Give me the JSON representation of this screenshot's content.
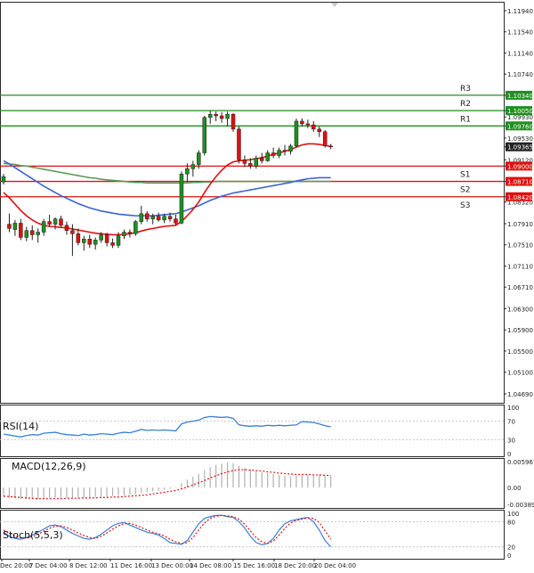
{
  "chart_data": [
    {
      "type": "candlestick",
      "panel": "main",
      "ylim": [
        1.0469,
        1.1194
      ],
      "y_ticks": [
        "1.11940",
        "1.11540",
        "1.11140",
        "1.10740",
        "1.10340",
        "1.10050",
        "1.09930",
        "1.09760",
        "1.09530",
        "1.09365",
        "1.09120",
        "1.09000",
        "1.08710",
        "1.08420",
        "1.08320",
        "1.07910",
        "1.07510",
        "1.07110",
        "1.06710",
        "1.06300",
        "1.05900",
        "1.05500",
        "1.05100",
        "1.04690"
      ],
      "highlighted_ticks": [
        {
          "label": "1.10340",
          "color": "#1f8f1f"
        },
        {
          "label": "1.10050",
          "color": "#1f8f1f"
        },
        {
          "label": "1.09760",
          "color": "#1f8f1f"
        },
        {
          "label": "1.09365",
          "color": "#222222"
        },
        {
          "label": "1.09000",
          "color": "#e01010"
        },
        {
          "label": "1.08710",
          "color": "#e01010"
        },
        {
          "label": "1.08420",
          "color": "#e01010"
        }
      ],
      "levels": [
        {
          "name": "R3",
          "value": 1.1034,
          "color": "#1f8f1f"
        },
        {
          "name": "R2",
          "value": 1.1005,
          "color": "#1f8f1f"
        },
        {
          "name": "R1",
          "value": 1.0976,
          "color": "#1f8f1f"
        },
        {
          "name": "S1",
          "value": 1.09,
          "color": "#e01010"
        },
        {
          "name": "S2",
          "value": 1.0871,
          "color": "#e01010"
        },
        {
          "name": "S3",
          "value": 1.0842,
          "color": "#e01010"
        }
      ],
      "last_price": 1.09365,
      "x_labels": [
        "Dec 20:00",
        "7 Dec 04:00",
        "8 Dec 12:00",
        "11 Dec 16:00",
        "13 Dec 00:00",
        "14 Dec 08:00",
        "15 Dec 16:00",
        "18 Dec 20:00",
        "20 Dec 04:00"
      ],
      "colors": {
        "up": "#1f8f1f",
        "down": "#e01010",
        "ma_fast": "#e01010",
        "ma_mid": "#3a63d6",
        "ma_slow": "#5a9a5a"
      },
      "candles": [
        {
          "o": 1.087,
          "h": 1.0885,
          "l": 1.0865,
          "c": 1.088
        },
        {
          "o": 1.079,
          "h": 1.081,
          "l": 1.0775,
          "c": 1.0782
        },
        {
          "o": 1.078,
          "h": 1.0798,
          "l": 1.0768,
          "c": 1.0792
        },
        {
          "o": 1.0792,
          "h": 1.08,
          "l": 1.076,
          "c": 1.0765
        },
        {
          "o": 1.0765,
          "h": 1.0785,
          "l": 1.0758,
          "c": 1.0778
        },
        {
          "o": 1.0778,
          "h": 1.0788,
          "l": 1.076,
          "c": 1.077
        },
        {
          "o": 1.077,
          "h": 1.0782,
          "l": 1.0755,
          "c": 1.0775
        },
        {
          "o": 1.0775,
          "h": 1.08,
          "l": 1.0768,
          "c": 1.0795
        },
        {
          "o": 1.0795,
          "h": 1.0808,
          "l": 1.0785,
          "c": 1.079
        },
        {
          "o": 1.079,
          "h": 1.0803,
          "l": 1.078,
          "c": 1.08
        },
        {
          "o": 1.08,
          "h": 1.0806,
          "l": 1.0785,
          "c": 1.0788
        },
        {
          "o": 1.0788,
          "h": 1.0795,
          "l": 1.077,
          "c": 1.0778
        },
        {
          "o": 1.0778,
          "h": 1.079,
          "l": 1.073,
          "c": 1.0772
        },
        {
          "o": 1.0772,
          "h": 1.0782,
          "l": 1.075,
          "c": 1.0755
        },
        {
          "o": 1.0755,
          "h": 1.0768,
          "l": 1.074,
          "c": 1.0762
        },
        {
          "o": 1.0762,
          "h": 1.077,
          "l": 1.0745,
          "c": 1.0752
        },
        {
          "o": 1.0752,
          "h": 1.0765,
          "l": 1.0742,
          "c": 1.076
        },
        {
          "o": 1.076,
          "h": 1.0775,
          "l": 1.0755,
          "c": 1.077
        },
        {
          "o": 1.077,
          "h": 1.0774,
          "l": 1.0748,
          "c": 1.0755
        },
        {
          "o": 1.0755,
          "h": 1.0763,
          "l": 1.0745,
          "c": 1.075
        },
        {
          "o": 1.075,
          "h": 1.0775,
          "l": 1.0745,
          "c": 1.0768
        },
        {
          "o": 1.0768,
          "h": 1.078,
          "l": 1.0762,
          "c": 1.0775
        },
        {
          "o": 1.0775,
          "h": 1.078,
          "l": 1.0765,
          "c": 1.0772
        },
        {
          "o": 1.0772,
          "h": 1.0798,
          "l": 1.0768,
          "c": 1.0795
        },
        {
          "o": 1.0795,
          "h": 1.0825,
          "l": 1.079,
          "c": 1.081
        },
        {
          "o": 1.081,
          "h": 1.0815,
          "l": 1.0795,
          "c": 1.08
        },
        {
          "o": 1.08,
          "h": 1.081,
          "l": 1.079,
          "c": 1.0805
        },
        {
          "o": 1.0805,
          "h": 1.0812,
          "l": 1.0795,
          "c": 1.0798
        },
        {
          "o": 1.0798,
          "h": 1.081,
          "l": 1.0792,
          "c": 1.0805
        },
        {
          "o": 1.0805,
          "h": 1.0812,
          "l": 1.0795,
          "c": 1.08
        },
        {
          "o": 1.08,
          "h": 1.0808,
          "l": 1.0788,
          "c": 1.0792
        },
        {
          "o": 1.0792,
          "h": 1.089,
          "l": 1.079,
          "c": 1.0885
        },
        {
          "o": 1.0885,
          "h": 1.0905,
          "l": 1.087,
          "c": 1.0895
        },
        {
          "o": 1.0895,
          "h": 1.091,
          "l": 1.088,
          "c": 1.0903
        },
        {
          "o": 1.0903,
          "h": 1.093,
          "l": 1.0895,
          "c": 1.0925
        },
        {
          "o": 1.0925,
          "h": 1.0995,
          "l": 1.092,
          "c": 1.0992
        },
        {
          "o": 1.0992,
          "h": 1.1005,
          "l": 1.098,
          "c": 1.0998
        },
        {
          "o": 1.0998,
          "h": 1.1003,
          "l": 1.0985,
          "c": 1.0995
        },
        {
          "o": 1.0995,
          "h": 1.1002,
          "l": 1.0982,
          "c": 1.099
        },
        {
          "o": 1.099,
          "h": 1.1003,
          "l": 1.0975,
          "c": 1.0998
        },
        {
          "o": 1.0998,
          "h": 1.1,
          "l": 1.0965,
          "c": 1.097
        },
        {
          "o": 1.097,
          "h": 1.0975,
          "l": 1.0905,
          "c": 1.0912
        },
        {
          "o": 1.0912,
          "h": 1.092,
          "l": 1.0898,
          "c": 1.0905
        },
        {
          "o": 1.0905,
          "h": 1.0915,
          "l": 1.0895,
          "c": 1.09
        },
        {
          "o": 1.09,
          "h": 1.092,
          "l": 1.0895,
          "c": 1.0915
        },
        {
          "o": 1.0915,
          "h": 1.0925,
          "l": 1.0905,
          "c": 1.091
        },
        {
          "o": 1.091,
          "h": 1.093,
          "l": 1.0908,
          "c": 1.0925
        },
        {
          "o": 1.0925,
          "h": 1.0935,
          "l": 1.0915,
          "c": 1.092
        },
        {
          "o": 1.092,
          "h": 1.0935,
          "l": 1.0915,
          "c": 1.093
        },
        {
          "o": 1.093,
          "h": 1.094,
          "l": 1.092,
          "c": 1.0928
        },
        {
          "o": 1.0928,
          "h": 1.0942,
          "l": 1.0922,
          "c": 1.0938
        },
        {
          "o": 1.0938,
          "h": 1.099,
          "l": 1.0935,
          "c": 1.0985
        },
        {
          "o": 1.0985,
          "h": 1.099,
          "l": 1.0975,
          "c": 1.098
        },
        {
          "o": 1.098,
          "h": 1.0988,
          "l": 1.0972,
          "c": 1.0978
        },
        {
          "o": 1.0978,
          "h": 1.0985,
          "l": 1.0965,
          "c": 1.097
        },
        {
          "o": 1.097,
          "h": 1.0975,
          "l": 1.0955,
          "c": 1.0965
        },
        {
          "o": 1.0965,
          "h": 1.0968,
          "l": 1.0935,
          "c": 1.0938
        },
        {
          "o": 1.0938,
          "h": 1.0942,
          "l": 1.0932,
          "c": 1.09365
        }
      ],
      "ma_fast": [
        1.085,
        1.084,
        1.0828,
        1.0816,
        1.0806,
        1.0798,
        1.0792,
        1.0788,
        1.0786,
        1.0785,
        1.0784,
        1.0783,
        1.0781,
        1.0779,
        1.0777,
        1.0775,
        1.0773,
        1.0772,
        1.0771,
        1.077,
        1.077,
        1.0771,
        1.0772,
        1.0774,
        1.0777,
        1.078,
        1.0782,
        1.0784,
        1.0786,
        1.0787,
        1.0788,
        1.0795,
        1.0806,
        1.0818,
        1.0832,
        1.085,
        1.0866,
        1.088,
        1.0892,
        1.0902,
        1.0908,
        1.091,
        1.0911,
        1.0912,
        1.0914,
        1.0916,
        1.0919,
        1.0922,
        1.0925,
        1.0928,
        1.0931,
        1.0936,
        1.094,
        1.0942,
        1.0942,
        1.0941,
        1.0939,
        1.0937
      ],
      "ma_mid": [
        1.091,
        1.0904,
        1.0897,
        1.089,
        1.0883,
        1.0876,
        1.0869,
        1.0862,
        1.0856,
        1.085,
        1.0844,
        1.0839,
        1.0834,
        1.0829,
        1.0825,
        1.0821,
        1.0818,
        1.0815,
        1.0813,
        1.0811,
        1.0809,
        1.0808,
        1.0807,
        1.0806,
        1.0806,
        1.0806,
        1.0806,
        1.0807,
        1.0808,
        1.0809,
        1.081,
        1.0813,
        1.0817,
        1.0821,
        1.0825,
        1.083,
        1.0835,
        1.0839,
        1.0843,
        1.0846,
        1.0849,
        1.0851,
        1.0853,
        1.0855,
        1.0857,
        1.0859,
        1.0861,
        1.0863,
        1.0865,
        1.0867,
        1.0869,
        1.0872,
        1.0874,
        1.0876,
        1.0877,
        1.0878,
        1.0878,
        1.0878
      ],
      "ma_slow": [
        1.0905,
        1.0904,
        1.0903,
        1.0901,
        1.09,
        1.0898,
        1.0896,
        1.0894,
        1.0892,
        1.089,
        1.0888,
        1.0886,
        1.0884,
        1.0882,
        1.088,
        1.0878,
        1.0877,
        1.0875,
        1.0874,
        1.0873,
        1.0872,
        1.0871,
        1.087,
        1.0869,
        1.0869,
        1.0868,
        1.0868,
        1.0868,
        1.0868,
        1.0868,
        1.0868,
        1.0868,
        1.0868,
        1.0869,
        1.0869,
        1.087,
        1.087,
        1.0871,
        1.0871,
        1.0871,
        1.0871,
        1.0871,
        1.0871,
        1.0871,
        1.0871,
        1.0871,
        1.0871,
        1.0871,
        1.0871,
        1.0871,
        1.0871,
        1.0871,
        1.0871,
        1.0871,
        1.0871,
        1.0871,
        1.0871,
        1.0871
      ]
    },
    {
      "type": "line",
      "panel": "rsi",
      "title": "RSI(14)",
      "ylim": [
        0,
        100
      ],
      "y_ticks": [
        "100",
        "70",
        "30",
        "0"
      ],
      "color": "#3a7fd6",
      "values": [
        42,
        40,
        38,
        36,
        39,
        41,
        40,
        44,
        45,
        46,
        43,
        41,
        40,
        39,
        42,
        40,
        41,
        43,
        42,
        41,
        44,
        46,
        45,
        48,
        52,
        50,
        51,
        50,
        51,
        50,
        49,
        64,
        68,
        70,
        72,
        78,
        80,
        79,
        78,
        79,
        76,
        62,
        60,
        59,
        60,
        59,
        61,
        60,
        61,
        60,
        61,
        62,
        69,
        68,
        67,
        64,
        60,
        58
      ]
    },
    {
      "type": "bar",
      "panel": "macd",
      "title": "MACD(12,26,9)",
      "ylim": [
        -0.003896,
        0.005967
      ],
      "y_ticks": [
        "0.005967",
        "0.00",
        "-0.003896"
      ],
      "bar_color": "#b0b0b0",
      "signal_color": "#e01010",
      "values": [
        -0.0022,
        -0.0024,
        -0.0025,
        -0.0026,
        -0.0027,
        -0.0027,
        -0.0027,
        -0.0026,
        -0.0025,
        -0.0024,
        -0.0024,
        -0.0024,
        -0.0024,
        -0.0024,
        -0.0023,
        -0.0023,
        -0.0022,
        -0.0021,
        -0.0021,
        -0.002,
        -0.0019,
        -0.0018,
        -0.0017,
        -0.0015,
        -0.0013,
        -0.0011,
        -0.0009,
        -0.0007,
        -0.0005,
        -0.0003,
        -0.0001,
        0.001,
        0.0018,
        0.0025,
        0.0031,
        0.004,
        0.0047,
        0.0052,
        0.0055,
        0.0057,
        0.0056,
        0.005,
        0.0045,
        0.0041,
        0.0038,
        0.0035,
        0.0033,
        0.0031,
        0.0029,
        0.0027,
        0.0025,
        0.0028,
        0.0029,
        0.003,
        0.003,
        0.0029,
        0.0027,
        0.0026
      ],
      "signal": [
        -0.002,
        -0.0021,
        -0.0022,
        -0.0023,
        -0.0024,
        -0.0025,
        -0.0026,
        -0.0026,
        -0.0026,
        -0.0026,
        -0.0026,
        -0.0025,
        -0.0025,
        -0.0025,
        -0.0024,
        -0.0024,
        -0.0024,
        -0.0023,
        -0.0023,
        -0.0022,
        -0.0022,
        -0.0021,
        -0.002,
        -0.0019,
        -0.0018,
        -0.0017,
        -0.0015,
        -0.0013,
        -0.0011,
        -0.0009,
        -0.0007,
        -0.0003,
        0.0001,
        0.0006,
        0.0011,
        0.0016,
        0.0022,
        0.0027,
        0.0032,
        0.0036,
        0.0039,
        0.0041,
        0.0041,
        0.004,
        0.0039,
        0.0038,
        0.0036,
        0.0035,
        0.0033,
        0.0032,
        0.0031,
        0.003,
        0.003,
        0.003,
        0.0029,
        0.0029,
        0.0028,
        0.0028
      ]
    },
    {
      "type": "line",
      "panel": "stoch",
      "title": "Stoch(5,5,3)",
      "ylim": [
        0,
        100
      ],
      "y_ticks": [
        "100",
        "80",
        "20",
        "0"
      ],
      "main_color": "#3a7fd6",
      "signal_color": "#e01010",
      "values": [
        55,
        45,
        40,
        38,
        42,
        48,
        55,
        62,
        70,
        72,
        68,
        60,
        52,
        46,
        40,
        38,
        42,
        50,
        60,
        70,
        76,
        78,
        72,
        66,
        60,
        55,
        52,
        48,
        40,
        30,
        28,
        26,
        35,
        55,
        75,
        88,
        92,
        95,
        95,
        92,
        90,
        80,
        65,
        45,
        30,
        25,
        28,
        40,
        60,
        75,
        82,
        85,
        88,
        90,
        80,
        60,
        35,
        20
      ],
      "signal": [
        60,
        52,
        46,
        42,
        41,
        44,
        50,
        57,
        64,
        69,
        70,
        66,
        60,
        53,
        47,
        42,
        40,
        45,
        53,
        62,
        70,
        75,
        76,
        72,
        66,
        60,
        55,
        51,
        46,
        38,
        32,
        28,
        30,
        42,
        60,
        77,
        88,
        93,
        95,
        94,
        92,
        86,
        74,
        58,
        42,
        32,
        28,
        34,
        48,
        64,
        77,
        83,
        86,
        89,
        88,
        78,
        58,
        38
      ]
    }
  ]
}
